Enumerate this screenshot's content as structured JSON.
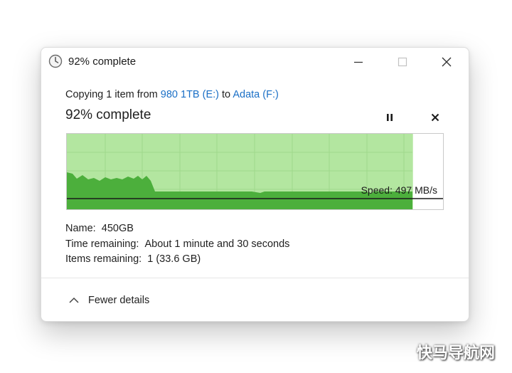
{
  "window": {
    "title": "92% complete",
    "controls": {
      "minimize_icon": "minimize-icon",
      "maximize_icon": "maximize-icon",
      "close_icon": "close-icon"
    }
  },
  "copy_info": {
    "prefix": "Copying 1 item from ",
    "source": "980 1TB (E:)",
    "middle": " to ",
    "destination": "Adata (F:)",
    "link_color": "#1a6fc6"
  },
  "progress": {
    "label": "92% complete",
    "fraction": 0.92,
    "pause_icon": "pause-icon",
    "cancel_icon": "cancel-icon",
    "fill_color": "#b3e6a0",
    "throughput_color": "#4caf3c"
  },
  "speed": {
    "text": "Speed: 497 MB/s"
  },
  "details": {
    "name_label": "Name:",
    "name_value": "450GB",
    "time_label": "Time remaining:",
    "time_value": "About 1 minute and 30 seconds",
    "items_label": "Items remaining:",
    "items_value": "1 (33.6 GB)"
  },
  "footer": {
    "toggle_label": "Fewer details",
    "toggle_icon": "chevron-up-icon"
  },
  "watermark": {
    "text": "快马导航网"
  }
}
